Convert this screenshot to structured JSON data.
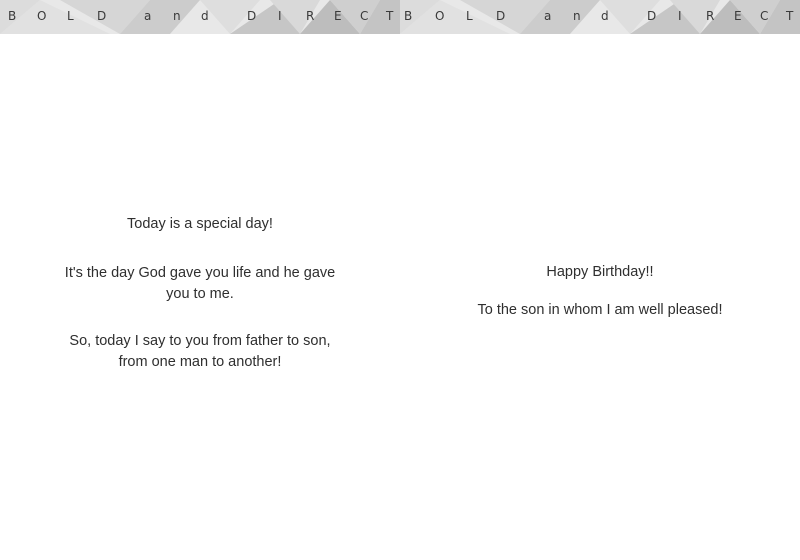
{
  "banner": {
    "letters": [
      "B",
      "O",
      "L",
      "D",
      "a",
      "n",
      "d",
      "D",
      "I",
      "R",
      "E",
      "C",
      "T"
    ]
  },
  "left_page": {
    "line1": "Today is a special day!",
    "line2": "It's the day God gave you life and he gave you to me.",
    "line3": "So, today I say to you from father to son, from one man to another!"
  },
  "right_page": {
    "line1": "Happy Birthday!!",
    "line2": "To the son in whom I am well pleased!"
  },
  "colors": {
    "banner_light": "#e6e6e6",
    "banner_mid": "#d2d2d2",
    "banner_dark": "#b9b9b9",
    "text": "#2f2f2f"
  }
}
